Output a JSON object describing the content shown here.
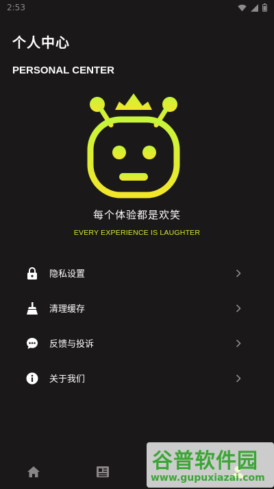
{
  "status_bar": {
    "time": "2:53",
    "icons": [
      "wifi-icon",
      "signal-icon",
      "battery-icon"
    ]
  },
  "header": {
    "title_cn": "个人中心",
    "title_en": "PERSONAL CENTER"
  },
  "mascot": {
    "icon": "robot-crown-mascot",
    "gradient_top": "#c6f53a",
    "gradient_bottom": "#f2e62a"
  },
  "slogan": {
    "cn": "每个体验都是欢笑",
    "en": "EVERY EXPERIENCE IS LAUGHTER"
  },
  "menu": {
    "items": [
      {
        "label": "隐私设置",
        "icon": "lock-icon"
      },
      {
        "label": "清理缓存",
        "icon": "broom-icon"
      },
      {
        "label": "反馈与投诉",
        "icon": "chat-bubble-icon"
      },
      {
        "label": "关于我们",
        "icon": "info-icon"
      }
    ]
  },
  "bottom_nav": {
    "items": [
      {
        "icon": "home-icon"
      },
      {
        "icon": "news-icon"
      },
      {
        "icon": "profile-icon"
      }
    ]
  },
  "watermark": {
    "cn": "谷普软件园",
    "url": "www.gupuxiazai.com"
  },
  "colors": {
    "background": "#1b1819",
    "accent": "#d6ea2e",
    "text": "#ffffff"
  }
}
